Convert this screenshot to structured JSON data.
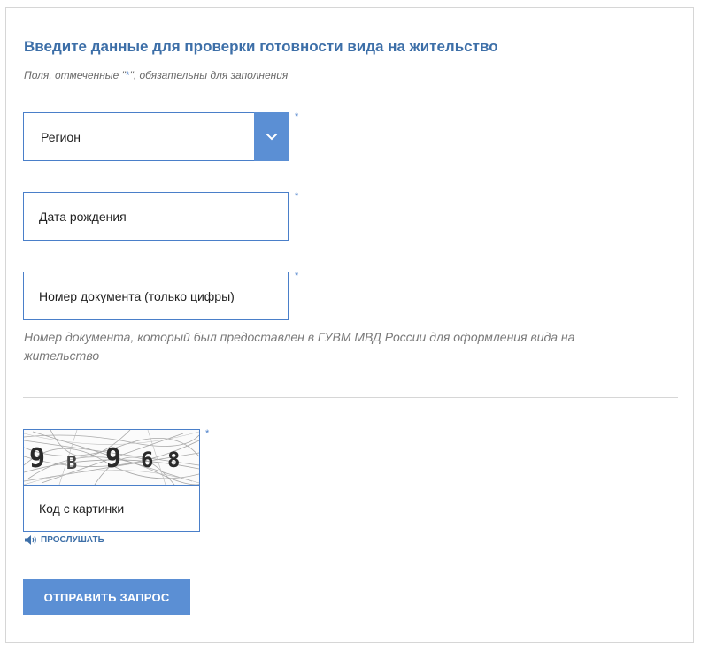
{
  "form": {
    "title": "Введите данные для проверки готовности вида на жительство",
    "required_hint_prefix": "Поля, отмеченные \"",
    "required_hint_star": "*",
    "required_hint_suffix": "\", обязательны для заполнения",
    "required_marker": "*"
  },
  "fields": {
    "region": {
      "placeholder": "Регион"
    },
    "birth_date": {
      "placeholder": "Дата рождения"
    },
    "document_number": {
      "placeholder": "Номер документа (только цифры)",
      "note": "Номер документа, который был предоставлен в ГУВМ МВД России для оформления вида на жительство"
    }
  },
  "captcha": {
    "image_text": [
      "9",
      "B",
      "9",
      "6",
      "8"
    ],
    "placeholder": "Код с картинки",
    "listen_label": "ПРОСЛУШАТЬ"
  },
  "actions": {
    "submit_label": "ОТПРАВИТЬ ЗАПРОС"
  },
  "colors": {
    "accent": "#5b8fd4",
    "title": "#3d6fa8",
    "border": "#4a7fc9"
  }
}
